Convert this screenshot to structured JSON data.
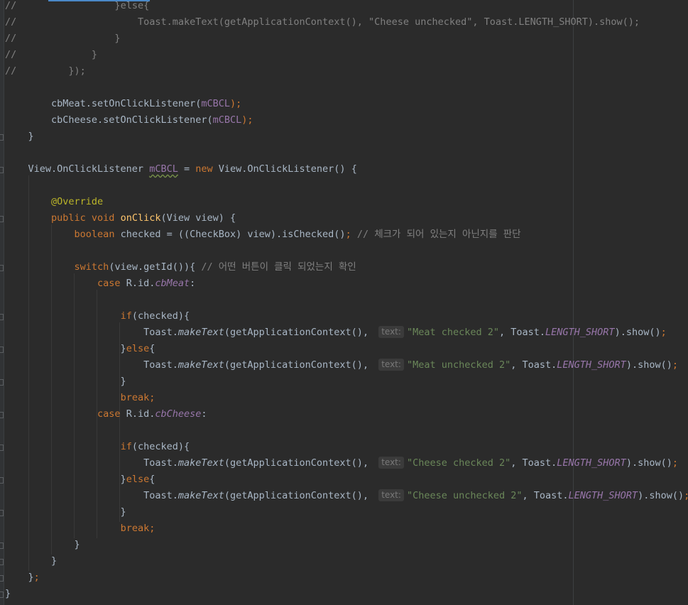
{
  "editor": {
    "language": "java",
    "theme_colors": {
      "background": "#2b2b2b",
      "text": "#a9b7c6",
      "keyword": "#cc7832",
      "comment": "#808080",
      "string": "#6a8759",
      "field": "#9876aa",
      "method": "#ffc66d",
      "annotation": "#bbb529",
      "hint": "#787878"
    },
    "lines": [
      [
        {
          "t": "//",
          "c": "comment"
        },
        {
          "t": "                 }else{",
          "c": "comment"
        }
      ],
      [
        {
          "t": "//",
          "c": "comment"
        },
        {
          "t": "                     Toast.makeText(getApplicationContext(), \"Cheese unchecked\", Toast.LENGTH_SHORT).show();",
          "c": "comment"
        }
      ],
      [
        {
          "t": "//",
          "c": "comment"
        },
        {
          "t": "                 }",
          "c": "comment"
        }
      ],
      [
        {
          "t": "//",
          "c": "comment"
        },
        {
          "t": "             }",
          "c": "comment"
        }
      ],
      [
        {
          "t": "//",
          "c": "comment"
        },
        {
          "t": "         });",
          "c": "comment"
        }
      ],
      [],
      [
        {
          "t": "        cbMeat.setOnClickListener(",
          "c": "plain"
        },
        {
          "t": "mCBCL",
          "c": "field"
        },
        {
          "t": ");",
          "c": "kw"
        }
      ],
      [
        {
          "t": "        cbCheese.setOnClickListener(",
          "c": "plain"
        },
        {
          "t": "mCBCL",
          "c": "field"
        },
        {
          "t": ");",
          "c": "kw"
        }
      ],
      [
        {
          "t": "    }",
          "c": "plain"
        }
      ],
      [],
      [
        {
          "t": "    View.OnClickListener ",
          "c": "plain"
        },
        {
          "t": "mCBCL",
          "c": "field",
          "u": true
        },
        {
          "t": " = ",
          "c": "plain"
        },
        {
          "t": "new",
          "c": "kw"
        },
        {
          "t": " View.OnClickListener() {",
          "c": "plain"
        }
      ],
      [],
      [
        {
          "t": "        @Override",
          "c": "anno"
        }
      ],
      [
        {
          "t": "        ",
          "c": "plain"
        },
        {
          "t": "public void ",
          "c": "kw"
        },
        {
          "t": "onClick",
          "c": "method"
        },
        {
          "t": "(View view) {",
          "c": "plain"
        }
      ],
      [
        {
          "t": "            ",
          "c": "plain"
        },
        {
          "t": "boolean ",
          "c": "kw"
        },
        {
          "t": "checked = ((CheckBox) view).isChecked()",
          "c": "plain"
        },
        {
          "t": "; ",
          "c": "kw"
        },
        {
          "t": "// 체크가 되어 있는지 아닌지를 판단",
          "c": "comment"
        }
      ],
      [],
      [
        {
          "t": "            ",
          "c": "plain"
        },
        {
          "t": "switch",
          "c": "kw"
        },
        {
          "t": "(view.getId()){ ",
          "c": "plain"
        },
        {
          "t": "// 어떤 버튼이 클릭 되었는지 확인",
          "c": "comment"
        }
      ],
      [
        {
          "t": "                ",
          "c": "plain"
        },
        {
          "t": "case ",
          "c": "kw"
        },
        {
          "t": "R.id.",
          "c": "plain"
        },
        {
          "t": "cbMeat",
          "c": "sfield"
        },
        {
          "t": ":",
          "c": "plain"
        }
      ],
      [],
      [
        {
          "t": "                    ",
          "c": "plain"
        },
        {
          "t": "if",
          "c": "kw"
        },
        {
          "t": "(checked){",
          "c": "plain"
        }
      ],
      [
        {
          "t": "                        Toast.",
          "c": "plain"
        },
        {
          "t": "makeText",
          "c": "static"
        },
        {
          "t": "(getApplicationContext(), ",
          "c": "plain"
        },
        {
          "h": "text:"
        },
        {
          "t": "\"Meat checked 2\"",
          "c": "str"
        },
        {
          "t": ", Toast.",
          "c": "plain"
        },
        {
          "t": "LENGTH_SHORT",
          "c": "sfield"
        },
        {
          "t": ").show()",
          "c": "plain"
        },
        {
          "t": ";",
          "c": "kw"
        }
      ],
      [
        {
          "t": "                    }",
          "c": "plain"
        },
        {
          "t": "else",
          "c": "kw"
        },
        {
          "t": "{",
          "c": "plain"
        }
      ],
      [
        {
          "t": "                        Toast.",
          "c": "plain"
        },
        {
          "t": "makeText",
          "c": "static"
        },
        {
          "t": "(getApplicationContext(), ",
          "c": "plain"
        },
        {
          "h": "text:"
        },
        {
          "t": "\"Meat unchecked 2\"",
          "c": "str"
        },
        {
          "t": ", Toast.",
          "c": "plain"
        },
        {
          "t": "LENGTH_SHORT",
          "c": "sfield"
        },
        {
          "t": ").show()",
          "c": "plain"
        },
        {
          "t": ";",
          "c": "kw"
        }
      ],
      [
        {
          "t": "                    }",
          "c": "plain"
        }
      ],
      [
        {
          "t": "                    ",
          "c": "plain"
        },
        {
          "t": "break;",
          "c": "kw"
        }
      ],
      [
        {
          "t": "                ",
          "c": "plain"
        },
        {
          "t": "case ",
          "c": "kw"
        },
        {
          "t": "R.id.",
          "c": "plain"
        },
        {
          "t": "cbCheese",
          "c": "sfield"
        },
        {
          "t": ":",
          "c": "plain"
        }
      ],
      [],
      [
        {
          "t": "                    ",
          "c": "plain"
        },
        {
          "t": "if",
          "c": "kw"
        },
        {
          "t": "(checked){",
          "c": "plain"
        }
      ],
      [
        {
          "t": "                        Toast.",
          "c": "plain"
        },
        {
          "t": "makeText",
          "c": "static"
        },
        {
          "t": "(getApplicationContext(), ",
          "c": "plain"
        },
        {
          "h": "text:"
        },
        {
          "t": "\"Cheese checked 2\"",
          "c": "str"
        },
        {
          "t": ", Toast.",
          "c": "plain"
        },
        {
          "t": "LENGTH_SHORT",
          "c": "sfield"
        },
        {
          "t": ").show()",
          "c": "plain"
        },
        {
          "t": ";",
          "c": "kw"
        }
      ],
      [
        {
          "t": "                    }",
          "c": "plain"
        },
        {
          "t": "else",
          "c": "kw"
        },
        {
          "t": "{",
          "c": "plain"
        }
      ],
      [
        {
          "t": "                        Toast.",
          "c": "plain"
        },
        {
          "t": "makeText",
          "c": "static"
        },
        {
          "t": "(getApplicationContext(), ",
          "c": "plain"
        },
        {
          "h": "text:"
        },
        {
          "t": "\"Cheese unchecked 2\"",
          "c": "str"
        },
        {
          "t": ", Toast.",
          "c": "plain"
        },
        {
          "t": "LENGTH_SHORT",
          "c": "sfield"
        },
        {
          "t": ").show()",
          "c": "plain"
        },
        {
          "t": ";",
          "c": "kw"
        }
      ],
      [
        {
          "t": "                    }",
          "c": "plain"
        }
      ],
      [
        {
          "t": "                    ",
          "c": "plain"
        },
        {
          "t": "break;",
          "c": "kw"
        }
      ],
      [
        {
          "t": "            }",
          "c": "plain"
        }
      ],
      [
        {
          "t": "        }",
          "c": "plain"
        }
      ],
      [
        {
          "t": "    }",
          "c": "plain"
        },
        {
          "t": ";",
          "c": "kw"
        }
      ],
      [
        {
          "t": "}",
          "c": "plain"
        }
      ]
    ]
  }
}
